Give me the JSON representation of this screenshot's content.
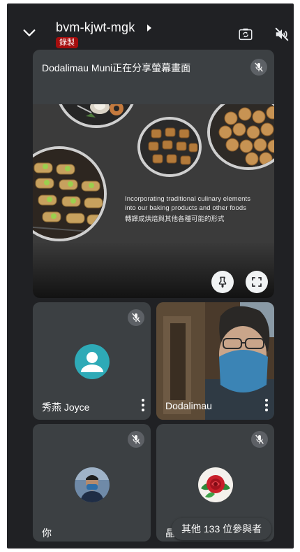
{
  "header": {
    "meeting_code": "bvm-kjwt-mgk",
    "recording_badge": "錄製",
    "icons": [
      "chevron-down-icon",
      "flip-camera-icon",
      "speaker-off-icon"
    ]
  },
  "presenter": {
    "label": "Dodalimau Muni正在分享螢幕畫面",
    "mic_muted": true,
    "slide": {
      "line1": "Incorporating traditional culinary elements",
      "line2": "into our baking products and other foods",
      "line3": "轉譯成烘焙與其他各種可能的形式"
    },
    "buttons": [
      "pin-icon",
      "fullscreen-icon"
    ]
  },
  "participants": [
    {
      "name": "秀燕 Joyce",
      "mic_muted": true,
      "avatar": "default-person-avatar"
    },
    {
      "name": "Dodalimau",
      "mic_muted": false,
      "avatar": "camera-video"
    },
    {
      "name": "你",
      "mic_muted": true,
      "avatar": "photo-avatar"
    },
    {
      "name": "晶",
      "mic_muted": true,
      "avatar": "rose-avatar"
    }
  ],
  "others_pill": "其他 133 位參與者",
  "colors": {
    "background": "#202124",
    "tile": "#3c4043",
    "recording": "#a50e0e",
    "avatar_teal": "#2eaab7"
  }
}
